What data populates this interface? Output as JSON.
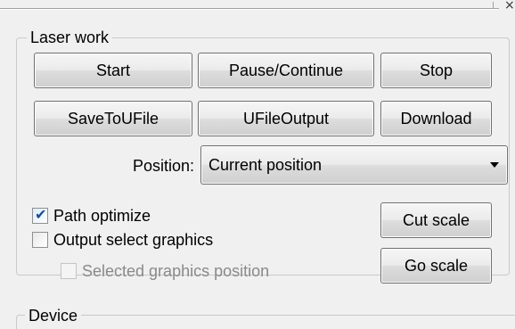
{
  "top_panel": {
    "close_glyph": "×"
  },
  "laser_work": {
    "title": "Laser work",
    "buttons": {
      "start": "Start",
      "pause_continue": "Pause/Continue",
      "stop": "Stop",
      "save_to_ufile": "SaveToUFile",
      "ufile_output": "UFileOutput",
      "download": "Download",
      "cut_scale": "Cut scale",
      "go_scale": "Go scale"
    },
    "position": {
      "label": "Position:",
      "value": "Current position"
    },
    "checkboxes": {
      "path_optimize": {
        "label": "Path optimize",
        "checked": true
      },
      "output_select_graphics": {
        "label": "Output select graphics",
        "checked": false
      },
      "selected_graphics_position": {
        "label": "Selected graphics position",
        "checked": false,
        "enabled": false
      }
    }
  },
  "device": {
    "title": "Device"
  }
}
